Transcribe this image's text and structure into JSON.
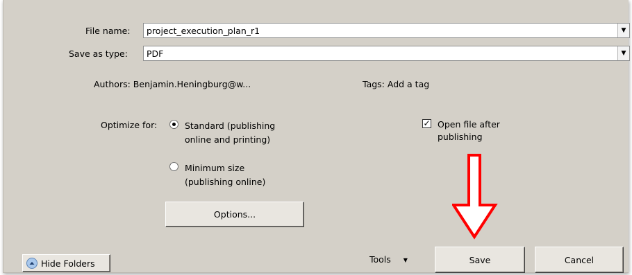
{
  "file_name": {
    "label": "File name:",
    "value": "project_execution_plan_r1",
    "dropdown_icon": "chevron-down-icon"
  },
  "save_as_type": {
    "label": "Save as type:",
    "value": "PDF",
    "dropdown_icon": "chevron-down-icon"
  },
  "authors": {
    "label": "Authors:",
    "value": "Benjamin.Heningburg@w..."
  },
  "tags": {
    "label": "Tags:",
    "value": "Add a tag"
  },
  "optimize": {
    "label": "Optimize for:",
    "options": [
      {
        "line1": "Standard (publishing",
        "line2": "online and printing)",
        "selected": true
      },
      {
        "line1": "Minimum size",
        "line2": "(publishing online)",
        "selected": false
      }
    ]
  },
  "open_after": {
    "line1": "Open file after",
    "line2": "publishing",
    "checked": true
  },
  "buttons": {
    "options": "Options...",
    "save": "Save",
    "cancel": "Cancel",
    "hide_folders": "Hide Folders",
    "tools": "Tools"
  },
  "annotation": {
    "type": "down-arrow",
    "color": "#ff0000"
  }
}
